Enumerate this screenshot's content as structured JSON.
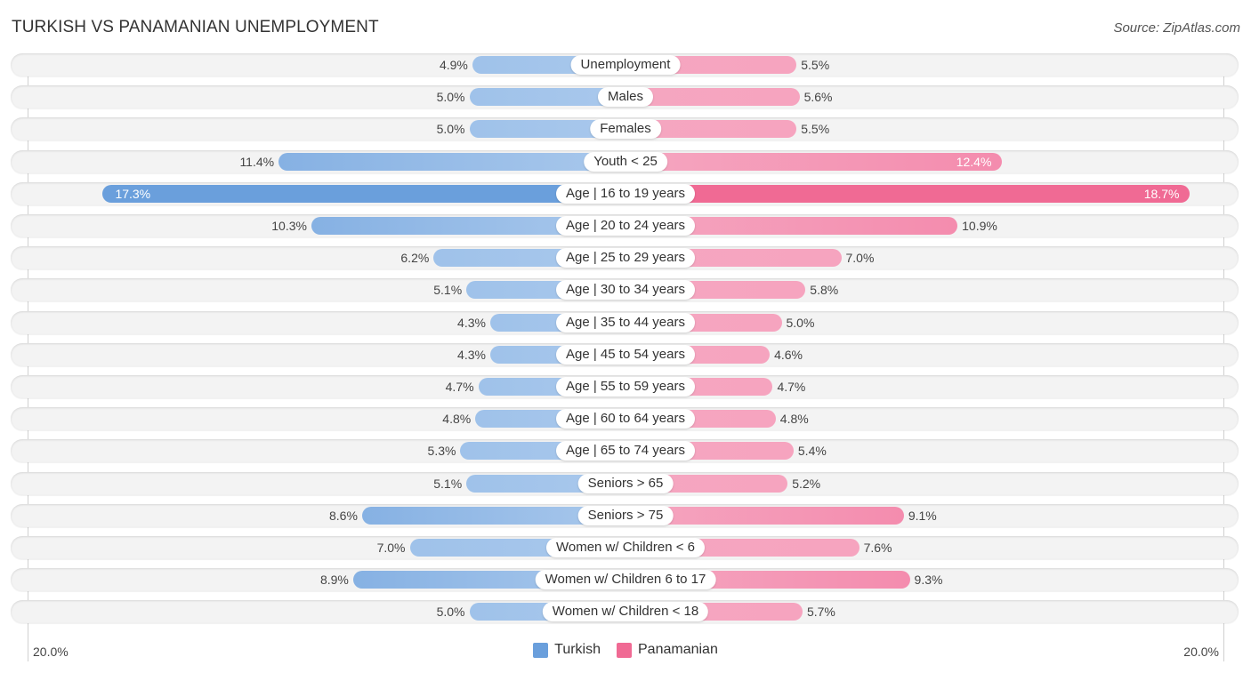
{
  "title": "TURKISH VS PANAMANIAN UNEMPLOYMENT",
  "source": "Source: ZipAtlas.com",
  "colors": {
    "turkish": "#6a9fdc",
    "turkish_light": "#a9c8ec",
    "panamanian": "#f06a94",
    "panamanian_light": "#f5a6c0"
  },
  "legend": [
    {
      "name": "Turkish",
      "color": "#6a9fdc"
    },
    {
      "name": "Panamanian",
      "color": "#f06a94"
    }
  ],
  "axis": {
    "left_label": "20.0%",
    "right_label": "20.0%"
  },
  "chart_data": {
    "type": "bar",
    "orientation": "horizontal-diverging",
    "title": "TURKISH VS PANAMANIAN UNEMPLOYMENT",
    "xlim": [
      -20,
      20
    ],
    "xlabel": "",
    "ylabel": "",
    "legend_position": "bottom-center",
    "categories": [
      "Unemployment",
      "Males",
      "Females",
      "Youth < 25",
      "Age | 16 to 19 years",
      "Age | 20 to 24 years",
      "Age | 25 to 29 years",
      "Age | 30 to 34 years",
      "Age | 35 to 44 years",
      "Age | 45 to 54 years",
      "Age | 55 to 59 years",
      "Age | 60 to 64 years",
      "Age | 65 to 74 years",
      "Seniors > 65",
      "Seniors > 75",
      "Women w/ Children < 6",
      "Women w/ Children 6 to 17",
      "Women w/ Children < 18"
    ],
    "series": [
      {
        "name": "Turkish",
        "values": [
          4.9,
          5.0,
          5.0,
          11.4,
          17.3,
          10.3,
          6.2,
          5.1,
          4.3,
          4.3,
          4.7,
          4.8,
          5.3,
          5.1,
          8.6,
          7.0,
          8.9,
          5.0
        ]
      },
      {
        "name": "Panamanian",
        "values": [
          5.5,
          5.6,
          5.5,
          12.4,
          18.7,
          10.9,
          7.0,
          5.8,
          5.0,
          4.6,
          4.7,
          4.8,
          5.4,
          5.2,
          9.1,
          7.6,
          9.3,
          5.7
        ]
      }
    ],
    "value_labels": {
      "Turkish": [
        "4.9%",
        "5.0%",
        "5.0%",
        "11.4%",
        "17.3%",
        "10.3%",
        "6.2%",
        "5.1%",
        "4.3%",
        "4.3%",
        "4.7%",
        "4.8%",
        "5.3%",
        "5.1%",
        "8.6%",
        "7.0%",
        "8.9%",
        "5.0%"
      ],
      "Panamanian": [
        "5.5%",
        "5.6%",
        "5.5%",
        "12.4%",
        "18.7%",
        "10.9%",
        "7.0%",
        "5.8%",
        "5.0%",
        "4.6%",
        "4.7%",
        "4.8%",
        "5.4%",
        "5.2%",
        "9.1%",
        "7.6%",
        "9.3%",
        "5.7%"
      ]
    },
    "tick_labels": [
      "20.0%",
      "20.0%"
    ]
  }
}
